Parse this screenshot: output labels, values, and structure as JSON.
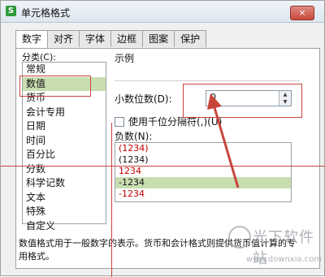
{
  "window": {
    "title": "单元格格式",
    "app_icon_glyph": "S",
    "close_glyph": "×"
  },
  "tabs": [
    {
      "label": "数字"
    },
    {
      "label": "对齐"
    },
    {
      "label": "字体"
    },
    {
      "label": "边框"
    },
    {
      "label": "图案"
    },
    {
      "label": "保护"
    }
  ],
  "category": {
    "label": "分类(C):",
    "items": [
      "常规",
      "数值",
      "货币",
      "会计专用",
      "日期",
      "时间",
      "百分比",
      "分数",
      "科学记数",
      "文本",
      "特殊",
      "自定义"
    ],
    "selected_index": 1
  },
  "sample": {
    "label": "示例"
  },
  "decimal": {
    "label": "小数位数(D):",
    "value": "0"
  },
  "separator": {
    "label": "使用千位分隔符(,)(U)",
    "checked": false
  },
  "negative": {
    "label": "负数(N):",
    "items": [
      {
        "text": "(1234)",
        "color": "#c00000"
      },
      {
        "text": "(1234)",
        "color": "#000000"
      },
      {
        "text": "1234",
        "color": "#c00000"
      },
      {
        "text": "-1234",
        "color": "#000000"
      },
      {
        "text": "-1234",
        "color": "#c00000"
      }
    ],
    "selected_index": 3
  },
  "description": "数值格式用于一般数字的表示。货币和会计格式则提供货币值计算的专用格式。",
  "watermark": {
    "brand": "光下软件站",
    "url": "www.downxia.com"
  },
  "colors": {
    "annotation": "#c8443a",
    "selection": "#c8ddb0",
    "negative_red": "#c00000"
  }
}
